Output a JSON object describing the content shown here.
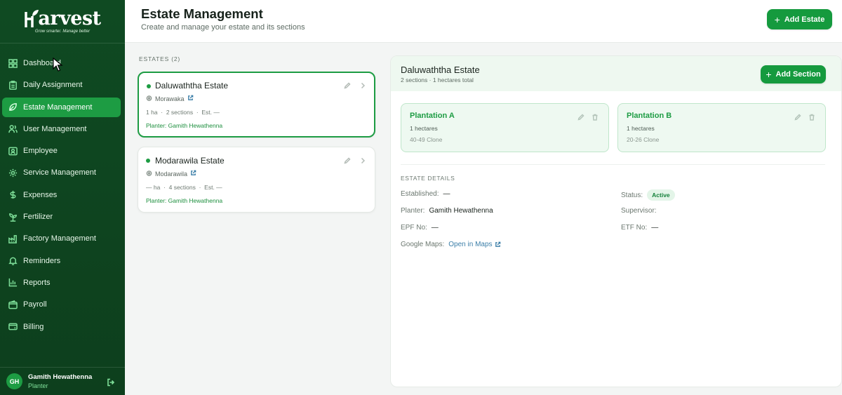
{
  "brand": {
    "name": "arvest",
    "tagline": "Grow smarter. Manage better"
  },
  "sidebar": {
    "items": [
      {
        "label": "Dashboard",
        "icon": "grid-icon"
      },
      {
        "label": "Daily Assignment",
        "icon": "clipboard-icon"
      },
      {
        "label": "Estate Management",
        "icon": "leaf-icon",
        "active": true
      },
      {
        "label": "User Management",
        "icon": "users-icon"
      },
      {
        "label": "Employee",
        "icon": "id-card-icon"
      },
      {
        "label": "Service Management",
        "icon": "gear-icon"
      },
      {
        "label": "Expenses",
        "icon": "dollar-icon"
      },
      {
        "label": "Fertilizer",
        "icon": "sprout-icon"
      },
      {
        "label": "Factory Management",
        "icon": "factory-icon"
      },
      {
        "label": "Reminders",
        "icon": "bell-icon"
      },
      {
        "label": "Reports",
        "icon": "bar-chart-icon"
      },
      {
        "label": "Payroll",
        "icon": "wallet-icon"
      },
      {
        "label": "Billing",
        "icon": "card-icon"
      }
    ],
    "user": {
      "initials": "GH",
      "name": "Gamith Hewathenna",
      "role": "Planter"
    }
  },
  "header": {
    "title": "Estate Management",
    "subtitle": "Create and manage your estate and its sections",
    "add_button": "Add Estate"
  },
  "estates": {
    "label": "ESTATES (2)",
    "list": [
      {
        "name": "Daluwaththa Estate",
        "location": "Morawaka",
        "hectares": "1 ha",
        "sections": "2 sections",
        "established": "Est. —",
        "planter": "Planter: Gamith Hewathenna"
      },
      {
        "name": "Modarawila Estate",
        "location": "Modarawila",
        "hectares": "— ha",
        "sections": "4 sections",
        "established": "Est. —",
        "planter": "Planter: Gamith Hewathenna"
      }
    ]
  },
  "detail": {
    "title": "Daluwaththa Estate",
    "subtitle": "2 sections · 1 hectares total",
    "add_section": "Add Section",
    "sections": [
      {
        "name": "Plantation A",
        "hectares": "1 hectares",
        "clone": "40-49 Clone"
      },
      {
        "name": "Plantation B",
        "hectares": "1 hectares",
        "clone": "20-26 Clone"
      }
    ],
    "details_label": "ESTATE DETAILS",
    "fields": {
      "established_label": "Established:",
      "established": "—",
      "status_label": "Status:",
      "status": "Active",
      "planter_label": "Planter:",
      "planter": "Gamith Hewathenna",
      "supervisor_label": "Supervisor:",
      "supervisor": "",
      "epf_label": "EPF No:",
      "epf": "—",
      "etf_label": "ETF No:",
      "etf": "—",
      "maps_label": "Google Maps:",
      "maps_link": "Open in Maps"
    }
  }
}
